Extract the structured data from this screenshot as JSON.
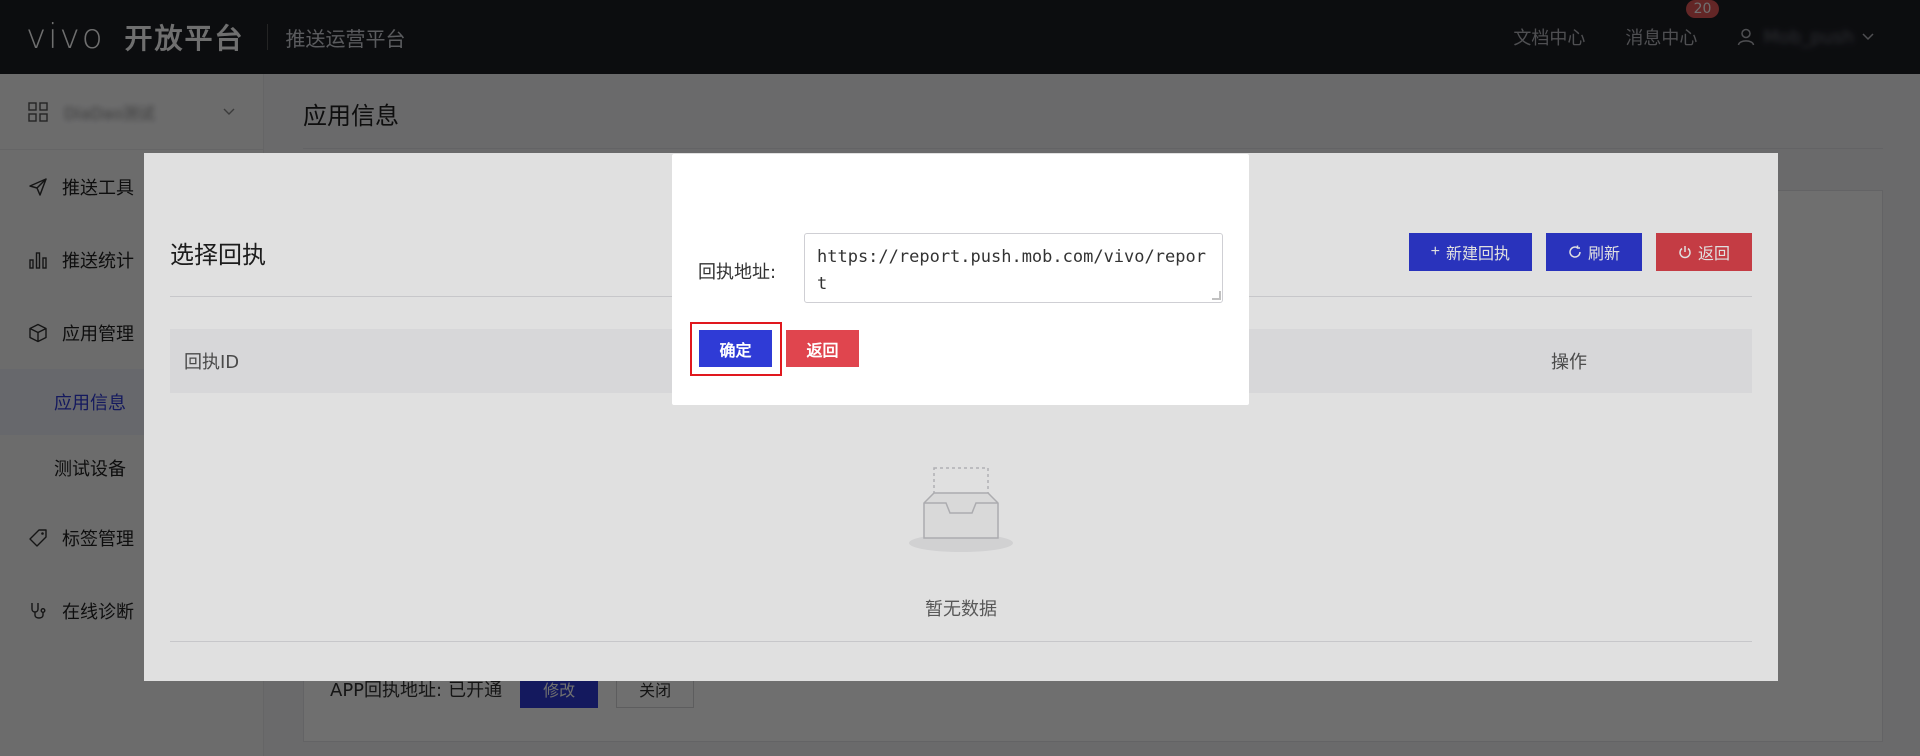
{
  "header": {
    "logo_vivo": "vivo",
    "logo_platform": "开放平台",
    "subtitle": "推送运营平台",
    "docs": "文档中心",
    "messages": "消息中心",
    "message_count": "20",
    "user_name": "Mob_push"
  },
  "sidebar": {
    "app_name": "DiaDao测试",
    "items": [
      {
        "label": "推送工具",
        "icon": "send-icon"
      },
      {
        "label": "推送统计",
        "icon": "bar-chart-icon"
      },
      {
        "label": "应用管理",
        "icon": "cube-icon"
      },
      {
        "label": "应用信息",
        "sub": true,
        "active": true
      },
      {
        "label": "测试设备",
        "sub": true
      },
      {
        "label": "标签管理",
        "icon": "tag-icon"
      },
      {
        "label": "在线诊断",
        "icon": "stethoscope-icon"
      }
    ]
  },
  "main": {
    "title": "应用信息",
    "callback_label": "APP回执地址:",
    "callback_status": "已开通",
    "modify_label": "修改",
    "close_label": "关闭"
  },
  "select_dialog": {
    "title": "选择回执",
    "new_label": "新建回执",
    "refresh_label": "刷新",
    "back_label": "返回",
    "col_id": "回执ID",
    "col_op": "操作",
    "empty_text": "暂无数据"
  },
  "url_dialog": {
    "field_label": "回执地址:",
    "url_value": "https://report.push.mob.com/vivo/report",
    "confirm_label": "确定",
    "back_label": "返回"
  },
  "colors": {
    "primary": "#2f3bd6",
    "danger": "#e0454e",
    "topbar": "#1d1f25",
    "highlight": "#e0181e"
  }
}
